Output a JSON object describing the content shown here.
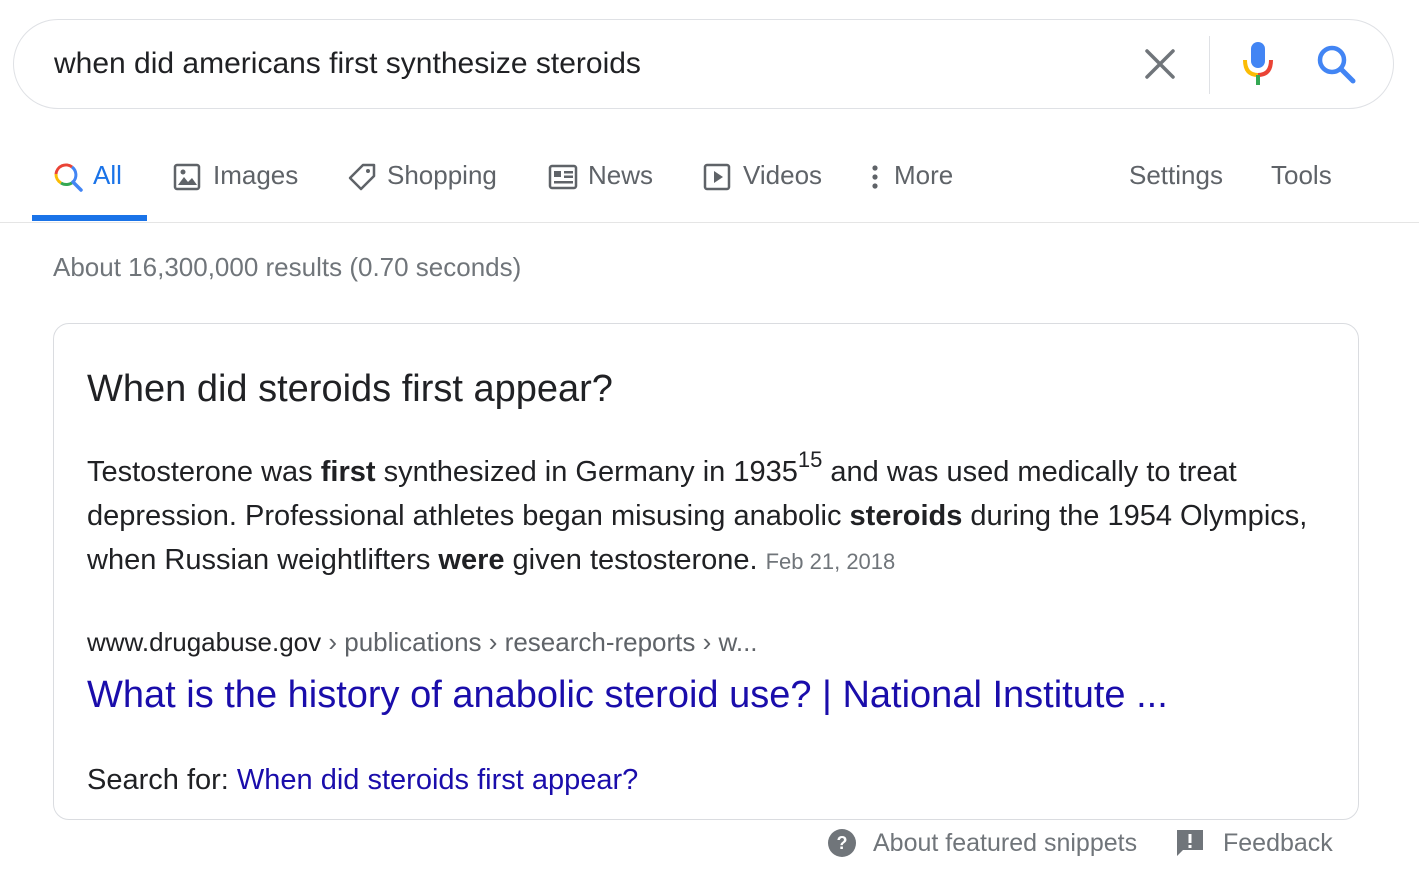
{
  "search": {
    "query": "when did americans first synthesize steroids"
  },
  "icons": {
    "clear": "close-icon",
    "mic": "microphone-icon",
    "search": "search-icon"
  },
  "tabs": [
    {
      "label": "All",
      "icon": "search-multicolor-icon",
      "active": true
    },
    {
      "label": "Images",
      "icon": "image-icon"
    },
    {
      "label": "Shopping",
      "icon": "tag-icon"
    },
    {
      "label": "News",
      "icon": "newspaper-icon"
    },
    {
      "label": "Videos",
      "icon": "play-icon"
    },
    {
      "label": "More",
      "icon": "more-vertical-icon"
    },
    {
      "label": "Settings"
    },
    {
      "label": "Tools"
    }
  ],
  "result_stats": "About 16,300,000 results (0.70 seconds)",
  "snippet": {
    "question": "When did steroids first appear?",
    "text_parts": {
      "p1": "Testosterone was ",
      "b1": "first",
      "p2": " synthesized in Germany in 1935",
      "sup": "15",
      "p3": " and was used medically to treat depression. Professional athletes began misusing anabolic ",
      "b2": "steroids",
      "p4": " during the 1954 Olympics, when Russian weightlifters ",
      "b3": "were",
      "p5": " given testosterone."
    },
    "date": "Feb 21, 2018",
    "cite_domain": "www.drugabuse.gov",
    "cite_path": " › publications › research-reports › w...",
    "link_title": "What is the history of anabolic steroid use? | National Institute ...",
    "search_for_label": "Search for: ",
    "search_for_link": "When did steroids first appear?"
  },
  "footer": {
    "about_label": "About featured snippets",
    "feedback_label": "Feedback"
  },
  "colors": {
    "accent": "#1a73e8",
    "link": "#1a0dab",
    "muted": "#70757a"
  }
}
